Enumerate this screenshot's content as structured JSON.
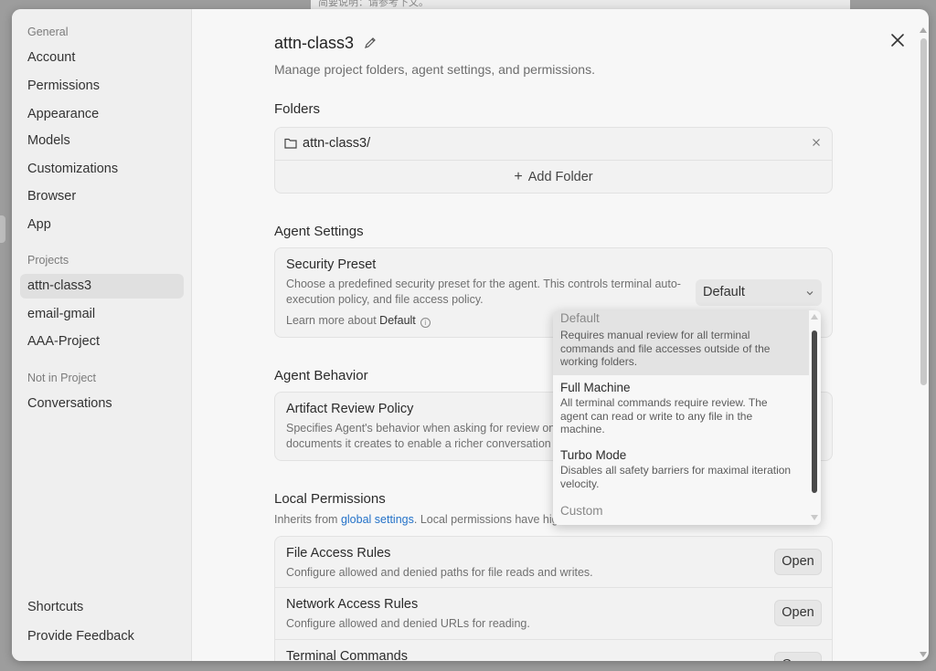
{
  "sidebar": {
    "general_label": "General",
    "general_items": [
      "Account",
      "Permissions",
      "Appearance",
      "Models",
      "Customizations",
      "Browser",
      "App"
    ],
    "projects_label": "Projects",
    "project_items": [
      "attn-class3",
      "email-gmail",
      "AAA-Project"
    ],
    "active_project": "attn-class3",
    "not_in_project_label": "Not in Project",
    "not_in_project_items": [
      "Conversations"
    ],
    "footer_items": [
      "Shortcuts",
      "Provide Feedback"
    ]
  },
  "header": {
    "title": "attn-class3",
    "subtitle": "Manage project folders, agent settings, and permissions."
  },
  "folders": {
    "heading": "Folders",
    "items": [
      "attn-class3/"
    ],
    "add_label": "Add Folder"
  },
  "agent_settings": {
    "heading": "Agent Settings",
    "security_preset": {
      "title": "Security Preset",
      "description_line1": "Choose a predefined security preset for the agent. This controls terminal auto-",
      "description_line2": "execution policy, and file access policy.",
      "learn_prefix": "Learn more about",
      "learn_target": "Default",
      "selected_value": "Default"
    }
  },
  "agent_behavior": {
    "heading": "Agent Behavior",
    "artifact_review": {
      "title": "Artifact Review Policy",
      "description_line1": "Specifies Agent's behavior when asking for review on",
      "description_line2": "documents it creates to enable a richer conversation e"
    }
  },
  "local_permissions": {
    "heading": "Local Permissions",
    "inherits_prefix": "Inherits from",
    "inherits_link": "global settings",
    "inherits_suffix": ". Local permissions have hig",
    "rows": [
      {
        "title": "File Access Rules",
        "description": "Configure allowed and denied paths for file reads and writes.",
        "button": "Open"
      },
      {
        "title": "Network Access Rules",
        "description": "Configure allowed and denied URLs for reading.",
        "button": "Open"
      },
      {
        "title": "Terminal Commands",
        "description": "",
        "button": "Open"
      }
    ]
  },
  "dropdown": {
    "options": [
      {
        "title": "Default",
        "desc1": "Requires manual review for all terminal",
        "desc2": "commands and file accesses outside of the",
        "desc3": "working folders."
      },
      {
        "title": "Full Machine",
        "desc1": "All terminal commands require review. The",
        "desc2": "agent can read or write to any file in the",
        "desc3": "machine."
      },
      {
        "title": "Turbo Mode",
        "desc1": "Disables all safety barriers for maximal iteration",
        "desc2": "velocity.",
        "desc3": ""
      },
      {
        "title": "Custom",
        "desc1": "",
        "desc2": "",
        "desc3": ""
      }
    ]
  },
  "backdrop": {
    "text": "简要说明：请参考下文。"
  },
  "colors": {
    "accent_link": "#2472c8",
    "sidebar_bg": "#efefef",
    "active_bg": "#e0e0e0"
  }
}
